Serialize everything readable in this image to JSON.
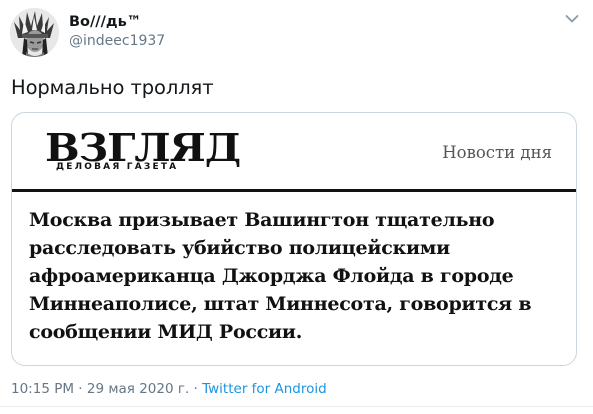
{
  "author": {
    "display_name": "Во///дь™",
    "handle": "@indeec1937"
  },
  "tweet": {
    "text": "Нормально троллят"
  },
  "card": {
    "logo_text": "ВЗГЛЯД",
    "logo_subtitle": "ДЕЛОВАЯ ГАЗЕТА",
    "section": "Новости дня",
    "headline": "Москва призывает Вашингтон тщательно расследовать убийство полицейскими афроамериканца Джорджа Флойда в городе Миннеаполисе, штат Миннесота, говорится в сообщении МИД России."
  },
  "meta": {
    "time": "10:15 PM",
    "separator": " · ",
    "date": "29 мая 2020 г.",
    "source": "Twitter for Android"
  },
  "icons": {
    "more": "chevron-down-icon"
  },
  "colors": {
    "link": "#1b95e0",
    "secondary_text": "#657786",
    "border": "#ccd6dd"
  }
}
